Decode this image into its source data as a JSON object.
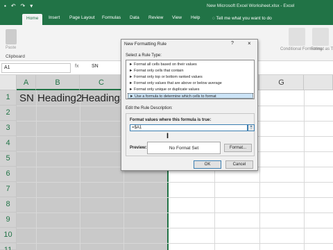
{
  "window": {
    "title": "New Microsoft Excel Worksheet.xlsx - Excel"
  },
  "ribbon": {
    "tabs": [
      {
        "label": "Home"
      },
      {
        "label": "Insert"
      },
      {
        "label": "Page Layout"
      },
      {
        "label": "Formulas"
      },
      {
        "label": "Data"
      },
      {
        "label": "Review"
      },
      {
        "label": "View"
      },
      {
        "label": "Help"
      }
    ],
    "tell_me": "Tell me what you want to do",
    "paste_label": "Paste",
    "clipboard_label": "Clipboard",
    "right_groups": [
      {
        "label": "Conditional Formatting"
      },
      {
        "label": "Format as Table"
      }
    ]
  },
  "formula_bar": {
    "name_box": "A1",
    "fx": "fx",
    "value": "SN"
  },
  "grid": {
    "columns": [
      "A",
      "B",
      "C",
      "D",
      "E",
      "F",
      "G"
    ],
    "rows": [
      "1",
      "2",
      "3",
      "4",
      "5",
      "6",
      "7",
      "8",
      "9",
      "10",
      "11"
    ],
    "cells": {
      "a1": "SN",
      "b1": "Heading2",
      "c1": "Heading3"
    }
  },
  "dialog": {
    "title": "New Formatting Rule",
    "help": "?",
    "close": "×",
    "select_rule_type_label": "Select a Rule Type:",
    "rule_types": [
      "► Format all cells based on their values",
      "► Format only cells that contain",
      "► Format only top or bottom ranked values",
      "► Format only values that are above or below average",
      "► Format only unique or duplicate values",
      "► Use a formula to determine which cells to format"
    ],
    "edit_description_label": "Edit the Rule Description:",
    "formula_caption": "Format values where this formula is true:",
    "formula_value": "=$A1",
    "preview_label": "Preview:",
    "preview_text": "No Format Set",
    "format_button": "Format...",
    "ok_button": "OK",
    "cancel_button": "Cancel"
  },
  "colors": {
    "excel_green": "#217346",
    "selection_blue": "#cce4f7"
  }
}
